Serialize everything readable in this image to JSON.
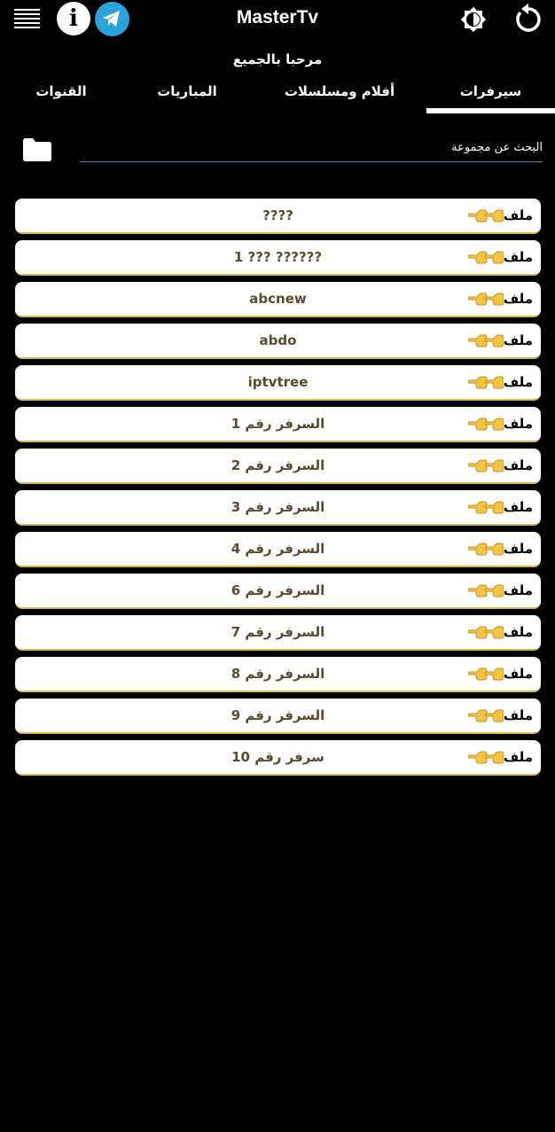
{
  "app": {
    "title": "MasterTv",
    "welcome": "مرحبا بالجميع"
  },
  "icons": {
    "menu": "menu-icon",
    "info": "info-icon",
    "info_glyph": "i",
    "telegram": "telegram-icon",
    "brightness": "brightness-icon",
    "refresh": "refresh-icon",
    "folder": "folder-icon",
    "pointing": "backhand-pointing-left-icon"
  },
  "colors": {
    "background": "#000000",
    "telegram": "#2AA3DB",
    "row_background": "#ffffff",
    "row_border": "#d8b94a",
    "row_text": "#5b4a2e",
    "search_underline": "#5b7bd5"
  },
  "tabs": [
    {
      "label": "سيرفرات",
      "active": true
    },
    {
      "label": "أفلام ومسلسلات",
      "active": false
    },
    {
      "label": "المباريات",
      "active": false
    },
    {
      "label": "القنوات",
      "active": false
    }
  ],
  "search": {
    "placeholder": "البحث عن مجموعة"
  },
  "servers": [
    {
      "tag": "ملف",
      "name": "????"
    },
    {
      "tag": "ملف",
      "name": "1 ??? ??????"
    },
    {
      "tag": "ملف",
      "name": "abcnew"
    },
    {
      "tag": "ملف",
      "name": "abdo"
    },
    {
      "tag": "ملف",
      "name": "iptvtree"
    },
    {
      "tag": "ملف",
      "name": "السرفر رقم 1"
    },
    {
      "tag": "ملف",
      "name": "السرفر رقم 2"
    },
    {
      "tag": "ملف",
      "name": "السرفر رقم 3"
    },
    {
      "tag": "ملف",
      "name": "السرفر رقم 4"
    },
    {
      "tag": "ملف",
      "name": "السرفر رقم 6"
    },
    {
      "tag": "ملف",
      "name": "السرفر رقم 7"
    },
    {
      "tag": "ملف",
      "name": "السرفر رقم 8"
    },
    {
      "tag": "ملف",
      "name": "السرفر رقم 9"
    },
    {
      "tag": "ملف",
      "name": "سرفر رقم 10"
    }
  ]
}
